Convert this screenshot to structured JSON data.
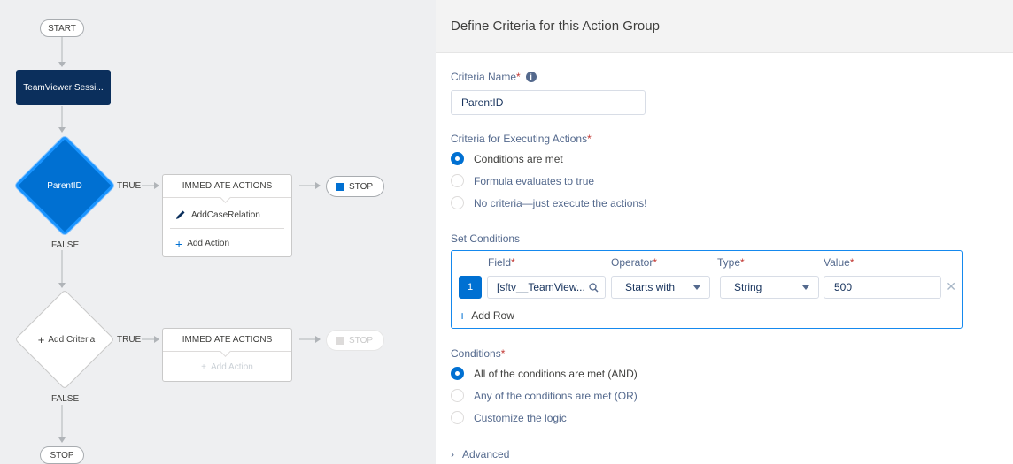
{
  "canvas": {
    "start_label": "START",
    "object_label": "TeamViewer Sessi...",
    "criteria_node": {
      "label": "ParentID",
      "true_label": "TRUE",
      "false_label": "FALSE",
      "actions_header": "IMMEDIATE ACTIONS",
      "action_item": "AddCaseRelation",
      "add_action": "Add Action",
      "stop_label": "STOP"
    },
    "empty_node": {
      "label": "Add Criteria",
      "true_label": "TRUE",
      "false_label": "FALSE",
      "actions_header": "IMMEDIATE ACTIONS",
      "add_action": "Add Action",
      "stop_label": "STOP"
    },
    "end_label": "STOP"
  },
  "panel": {
    "title": "Define Criteria for this Action Group",
    "criteria_name": {
      "label": "Criteria Name",
      "value": "ParentID"
    },
    "executing": {
      "label": "Criteria for Executing Actions",
      "options": [
        "Conditions are met",
        "Formula evaluates to true",
        "No criteria—just execute the actions!"
      ],
      "selected": 0
    },
    "set_conditions": {
      "label": "Set Conditions",
      "headers": {
        "field": "Field",
        "operator": "Operator",
        "type": "Type",
        "value": "Value"
      },
      "row": {
        "num": "1",
        "field": "[sftv__TeamView...",
        "operator": "Starts with",
        "type": "String",
        "value": "500"
      },
      "add_row": "Add Row"
    },
    "conditions": {
      "label": "Conditions",
      "options": [
        "All of the conditions are met (AND)",
        "Any of the conditions are met (OR)",
        "Customize the logic"
      ],
      "selected": 0
    },
    "advanced_label": "Advanced"
  },
  "colors": {
    "accent": "#0070d2",
    "node_dark": "#0b2f5c",
    "required": "#c23934"
  }
}
